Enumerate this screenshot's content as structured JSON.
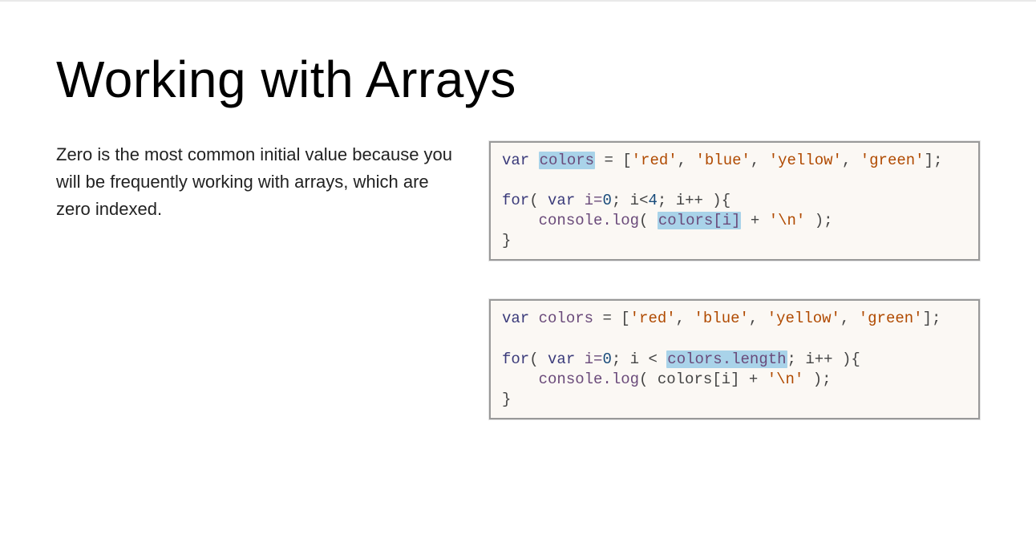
{
  "slide": {
    "title": "Working with Arrays",
    "body_text": "Zero is the most common initial value because you will be frequently working with arrays, which are zero indexed."
  },
  "code1": {
    "t": {
      "var": "var",
      "colors": "colors",
      "eq": " = [",
      "red": "'red'",
      "c1": ", ",
      "blue": "'blue'",
      "c2": ", ",
      "yellow": "'yellow'",
      "c3": ", ",
      "green": "'green'",
      "end": "];",
      "for": "for",
      "fopen": "( ",
      "vari": "var",
      "sp1": " i=",
      "zero": "0",
      "semi1": "; i<",
      "four": "4",
      "semi2": "; i++ ){",
      "indent": "    console.",
      "log": "log",
      "lparen": "( ",
      "colorsi": "colors[i]",
      "plus": " + ",
      "nl": "'\\n'",
      "rparen": " );",
      "close": "}"
    }
  },
  "code2": {
    "t": {
      "var": "var",
      "colors": "colors",
      "eq": " = [",
      "red": "'red'",
      "c1": ", ",
      "blue": "'blue'",
      "c2": ", ",
      "yellow": "'yellow'",
      "c3": ", ",
      "green": "'green'",
      "end": "];",
      "for": "for",
      "fopen": "( ",
      "vari": "var",
      "sp1": " i=",
      "zero": "0",
      "semi1": "; i < ",
      "clen": "colors.length",
      "semi2": "; i++ ){",
      "indent": "    console.",
      "log": "log",
      "lparen": "( colors[i] + ",
      "nl": "'\\n'",
      "rparen": " );",
      "close": "}"
    }
  }
}
